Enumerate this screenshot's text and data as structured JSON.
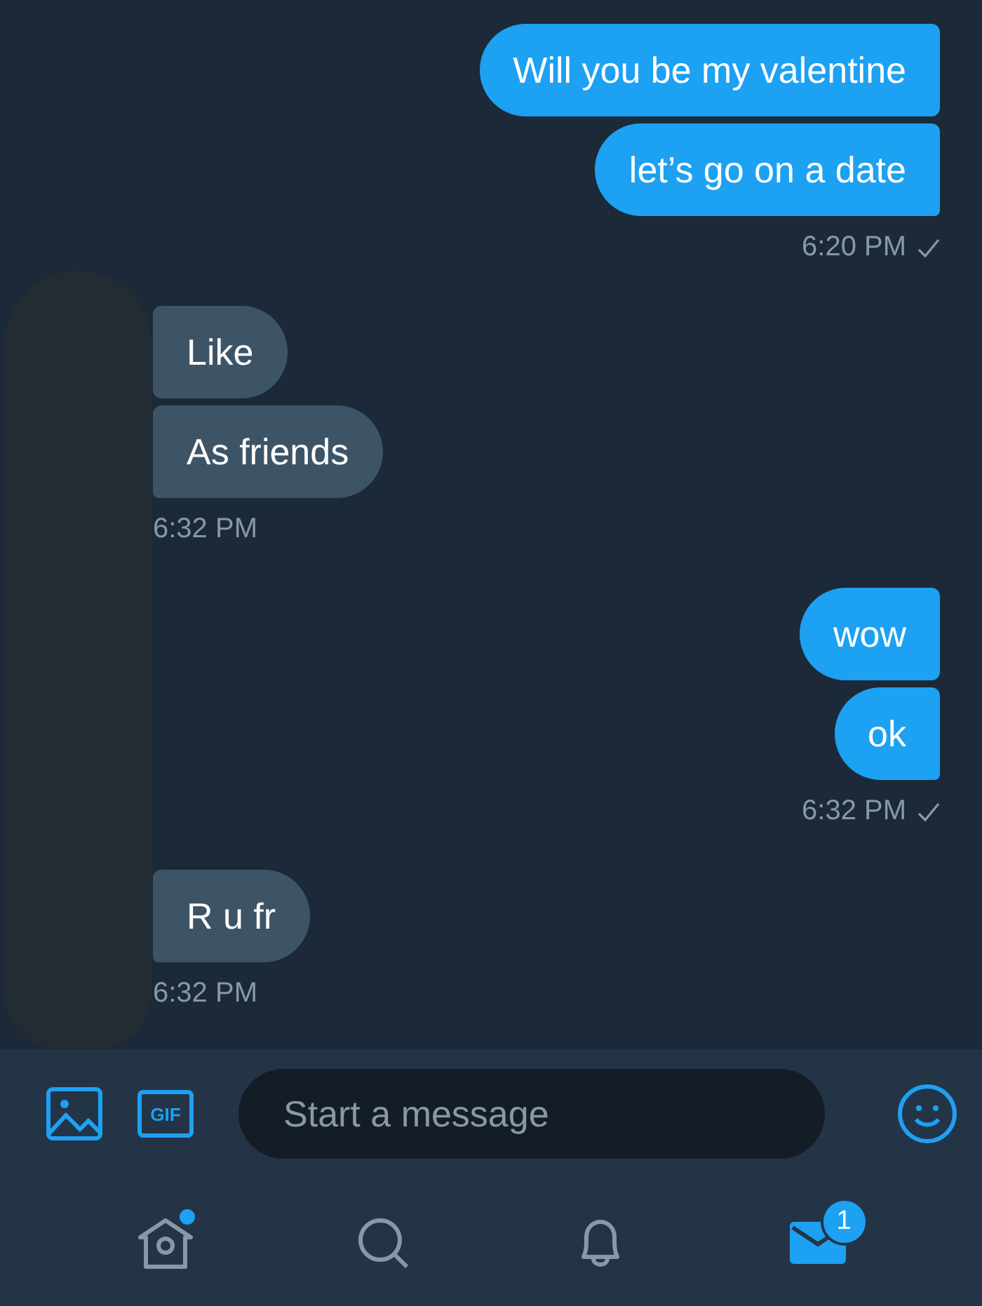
{
  "conversation": [
    {
      "kind": "outgoing",
      "messages": [
        "Will you be my valentine",
        "let’s go on a date"
      ],
      "time": "6:20 PM",
      "read": true
    },
    {
      "kind": "incoming",
      "messages": [
        "Like",
        "As friends"
      ],
      "time": "6:32 PM",
      "read": false
    },
    {
      "kind": "outgoing",
      "messages": [
        "wow",
        "ok"
      ],
      "time": "6:32 PM",
      "read": true
    },
    {
      "kind": "incoming",
      "messages": [
        "R u fr"
      ],
      "time": "6:32 PM",
      "read": false
    }
  ],
  "composer": {
    "placeholder": "Start a message",
    "gif_label": "GIF"
  },
  "tabs": [
    {
      "kind": "home",
      "selected": false,
      "dot": true
    },
    {
      "kind": "search",
      "selected": false,
      "dot": false
    },
    {
      "kind": "notifications",
      "selected": false,
      "dot": false
    },
    {
      "kind": "messages",
      "selected": true,
      "dot": false,
      "badge": "1"
    }
  ]
}
